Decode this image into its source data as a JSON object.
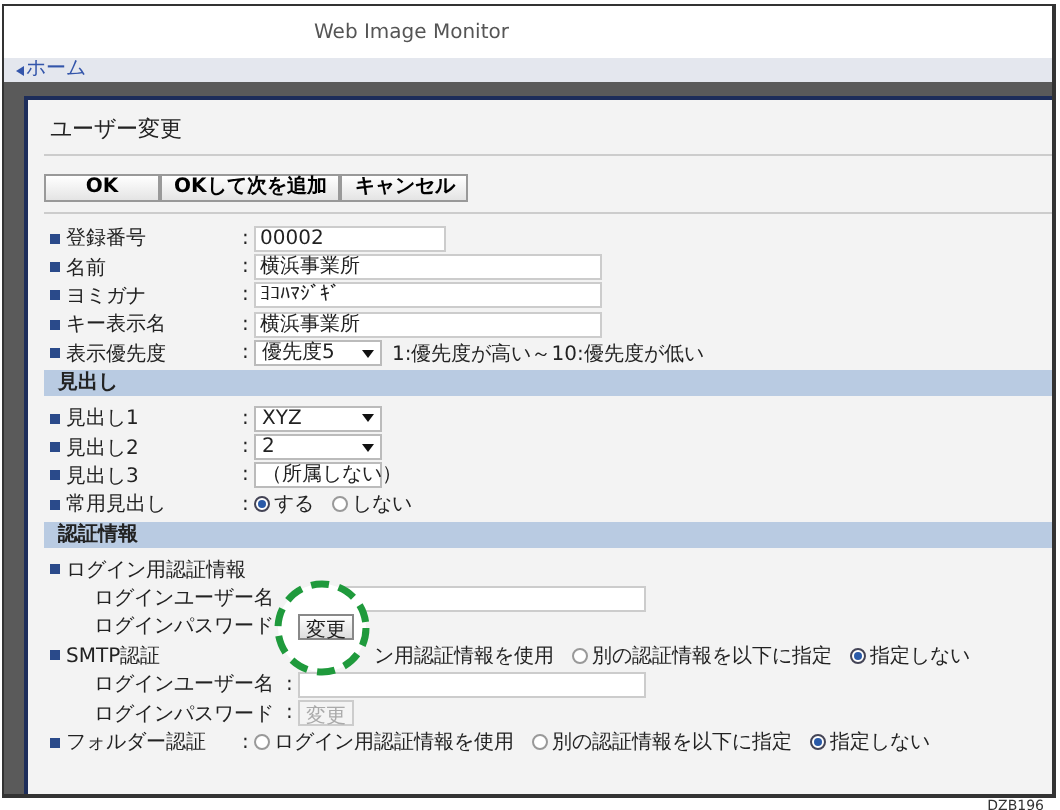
{
  "header": {
    "title": "Web Image Monitor"
  },
  "nav": {
    "home_link": "ホーム"
  },
  "dialog": {
    "title": "ユーザー変更",
    "buttons": [
      "OK",
      "OKして次を追加",
      "キャンセル"
    ]
  },
  "sections": [
    {
      "rows": [
        {
          "kind": "short_input",
          "label": "登録番号",
          "colon": ":",
          "value": "00002"
        },
        {
          "kind": "input",
          "label": "名前",
          "colon": ":",
          "value": "横浜事業所"
        },
        {
          "kind": "input",
          "label": "ヨミガナ",
          "colon": ":",
          "value": "ﾖｺﾊﾏｼﾞｷﾞ"
        },
        {
          "kind": "input",
          "label": "キー表示名",
          "colon": ":",
          "value": "横浜事業所"
        },
        {
          "kind": "select",
          "label": "表示優先度",
          "colon": ":",
          "value": "優先度5",
          "hint": "1:優先度が高い～10:優先度が低い"
        }
      ]
    },
    {
      "heading": "見出し",
      "rows": [
        {
          "kind": "select",
          "label": "見出し1",
          "colon": ":",
          "value": "XYZ"
        },
        {
          "kind": "select",
          "label": "見出し2",
          "colon": ":",
          "value": "2"
        },
        {
          "kind": "select",
          "label": "見出し3",
          "colon": ":",
          "value": "（所属しない）"
        },
        {
          "kind": "radio",
          "label": "常用見出し",
          "colon": ":",
          "options": [
            {
              "label": "する",
              "selected": true
            },
            {
              "label": "しない",
              "selected": false
            }
          ]
        }
      ]
    },
    {
      "heading": "認証情報",
      "rows": [
        {
          "kind": "group",
          "label": "ログイン用認証情報"
        },
        {
          "kind": "sub_input",
          "label": "ログインユーザー名"
        },
        {
          "kind": "sub_button",
          "label": "ログインパスワード",
          "button": "変更",
          "disabled": false,
          "highlighted": true
        },
        {
          "kind": "radio",
          "label": "SMTP認証",
          "options": [
            {
              "kind": "cut",
              "label": "ン用認証情報を使用"
            },
            {
              "label": "別の認証情報を以下に指定",
              "selected": false
            },
            {
              "label": "指定しない",
              "selected": true
            }
          ]
        },
        {
          "kind": "sub_input",
          "label": "ログインユーザー名",
          "colon": ":"
        },
        {
          "kind": "sub_button",
          "label": "ログインパスワード",
          "colon": ":",
          "button": "変更",
          "disabled": true,
          "highlighted": false
        },
        {
          "kind": "radio",
          "label": "フォルダー認証",
          "colon": ":",
          "options": [
            {
              "label": "ログイン用認証情報を使用",
              "selected": false
            },
            {
              "label": "別の認証情報を以下に指定",
              "selected": false
            },
            {
              "label": "指定しない",
              "selected": true
            }
          ]
        }
      ]
    }
  ],
  "figure_code": "DZB196"
}
